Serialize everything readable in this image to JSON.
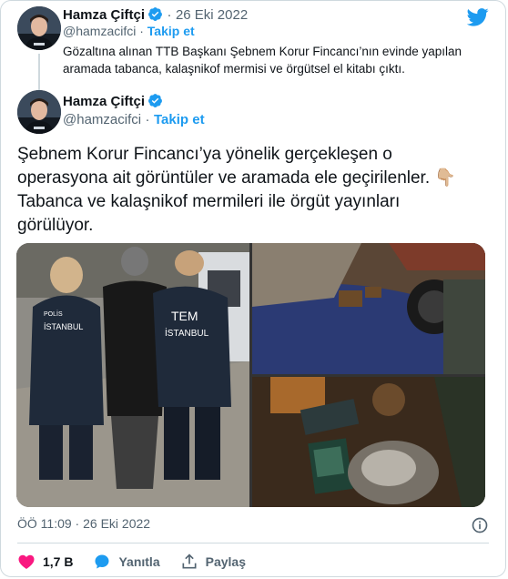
{
  "quoted_tweet": {
    "author_name": "Hamza Çiftçi",
    "handle": "@hamzacifci",
    "separator": "·",
    "date": "26 Eki 2022",
    "follow_label": "Takip et",
    "text": "Gözaltına alınan TTB Başkanı Şebnem Korur Fincancı’nın evinde yapılan aramada tabanca, kalaşnikof mermisi ve örgütsel el kitabı çıktı."
  },
  "main_tweet": {
    "author_name": "Hamza Çiftçi",
    "handle": "@hamzacifci",
    "separator": "·",
    "follow_label": "Takip et",
    "text_line1": "Şebnem Korur Fincancı’ya yönelik gerçekleşen o",
    "text_line2": "operasyona ait görüntüler ve aramada ele geçirilenler. 👇🏼",
    "text_line3": "Tabanca ve kalaşnikof mermileri ile örgüt yayınları",
    "text_line4": "görülüyor.",
    "timestamp": "ÖÖ 11:09 · 26 Eki 2022",
    "photo_vest_text_1": "POLİS",
    "photo_vest_text_2": "İSTANBUL",
    "photo_vest_text_3": "TEM",
    "photo_vest_text_4": "İSTANBUL"
  },
  "actions": {
    "like_count": "1,7 B",
    "reply_label": "Yanıtla",
    "share_label": "Paylaş"
  },
  "colors": {
    "accent": "#1d9bf0",
    "like": "#f91880",
    "text": "#0f1419",
    "muted": "#536471"
  },
  "icons": [
    "twitter-bird-icon",
    "verified-badge-icon",
    "info-icon",
    "heart-icon",
    "reply-icon",
    "share-icon"
  ]
}
